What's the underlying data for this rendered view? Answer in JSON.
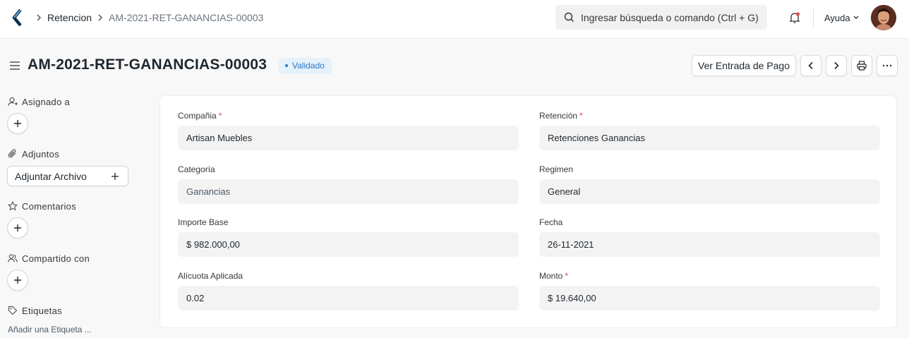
{
  "navbar": {
    "breadcrumbs": [
      "Retencion",
      "AM-2021-RET-GANANCIAS-00003"
    ],
    "search_placeholder": "Ingresar búsqueda o comando (Ctrl + G)",
    "help_label": "Ayuda",
    "icons": [
      "app-logo-icon",
      "chevron-right-icon",
      "search-icon",
      "bell-icon",
      "chevron-down-icon",
      "avatar"
    ]
  },
  "page": {
    "title": "AM-2021-RET-GANANCIAS-00003",
    "status": "Validado",
    "status_color": "#2b79c2",
    "actions": {
      "primary_label": "Ver Entrada de Pago",
      "icons": [
        "chevron-left-icon",
        "chevron-right-icon",
        "printer-icon",
        "more-icon"
      ]
    }
  },
  "sidebar": {
    "assigned_to": "Asignado a",
    "attachments": "Adjuntos",
    "attach_file": "Adjuntar Archivo",
    "comments": "Comentarios",
    "shared_with": "Compartido con",
    "tags": "Etiquetas",
    "add_tag": "Añadir una Etiqueta ..."
  },
  "form": {
    "left": [
      {
        "label": "Compañia",
        "required": true,
        "value": "Artisan Muebles"
      },
      {
        "label": "Categoría",
        "required": false,
        "value": "Ganancias"
      },
      {
        "label": "Importe Base",
        "required": false,
        "value": "$ 982.000,00"
      },
      {
        "label": "Alícuota Aplicada",
        "required": false,
        "value": "0.02"
      }
    ],
    "right": [
      {
        "label": "Retención",
        "required": true,
        "value": "Retenciones Ganancias"
      },
      {
        "label": "Regimen",
        "required": false,
        "value": "General"
      },
      {
        "label": "Fecha",
        "required": false,
        "value": "26-11-2021"
      },
      {
        "label": "Monto",
        "required": true,
        "value": "$ 19.640,00"
      }
    ],
    "required_marker": "*",
    "required_color": "#e24c4c"
  }
}
